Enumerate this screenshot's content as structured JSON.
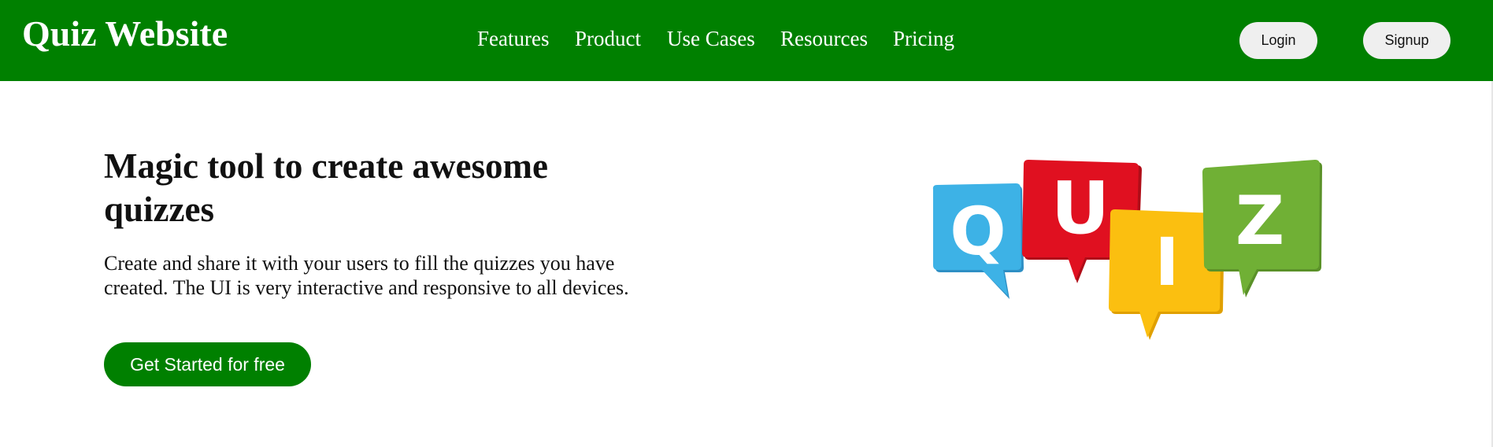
{
  "navbar": {
    "brand": "Quiz Website",
    "links": [
      "Features",
      "Product",
      "Use Cases",
      "Resources",
      "Pricing"
    ],
    "login_label": "Login",
    "signup_label": "Signup",
    "background_color": "#008000"
  },
  "hero": {
    "title": "Magic tool to create awesome quizzes",
    "description": "Create and share it with your users to fill the quizzes you have created. The UI is very interactive and responsive to all devices.",
    "cta_label": "Get Started for free",
    "illustration": {
      "name": "quiz-speech-bubbles-logo",
      "letters": [
        "Q",
        "U",
        "I",
        "Z"
      ],
      "colors": [
        "#3db2e6",
        "#e01020",
        "#fbbf10",
        "#70b035"
      ]
    }
  }
}
